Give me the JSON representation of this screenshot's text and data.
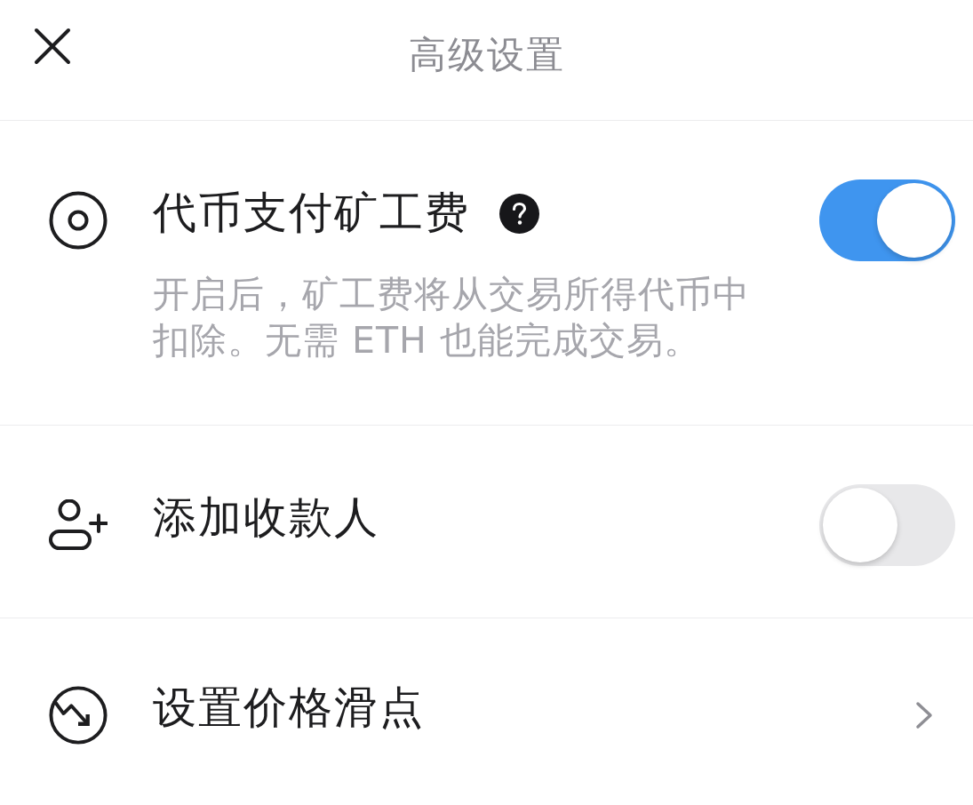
{
  "header": {
    "title": "高级设置"
  },
  "settings": [
    {
      "kind": "toggle",
      "title": "代币支付矿工费",
      "help": true,
      "description": "开启后，矿工费将从交易所得代币中扣除。无需 ETH 也能完成交易。",
      "on": true
    },
    {
      "kind": "toggle",
      "title": "添加收款人",
      "on": false
    },
    {
      "kind": "link",
      "title": "设置价格滑点"
    }
  ]
}
